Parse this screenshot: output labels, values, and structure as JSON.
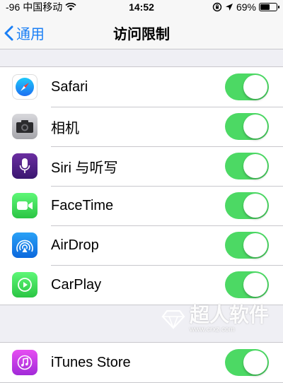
{
  "status_bar": {
    "signal": "-96",
    "carrier": "中国移动",
    "time": "14:52",
    "battery": "69%",
    "battery_level": 0.69
  },
  "nav": {
    "back_label": "通用",
    "title": "访问限制"
  },
  "group1": [
    {
      "label": "Safari",
      "icon": "safari-icon",
      "enabled": true
    },
    {
      "label": "相机",
      "icon": "camera-icon",
      "enabled": true
    },
    {
      "label": "Siri 与听写",
      "icon": "siri-icon",
      "enabled": true
    },
    {
      "label": "FaceTime",
      "icon": "facetime-icon",
      "enabled": true
    },
    {
      "label": "AirDrop",
      "icon": "airdrop-icon",
      "enabled": true
    },
    {
      "label": "CarPlay",
      "icon": "carplay-icon",
      "enabled": true
    }
  ],
  "group2": [
    {
      "label": "iTunes Store",
      "icon": "itunes-icon",
      "enabled": true
    }
  ],
  "watermark": {
    "brand": "超人软件",
    "url": "www.crxz.com"
  },
  "colors": {
    "accent": "#1a7ff5",
    "toggle_on": "#4cd964",
    "background": "#efeff4"
  }
}
